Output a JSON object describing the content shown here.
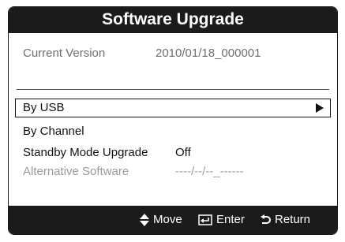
{
  "dialog": {
    "title": "Software Upgrade",
    "current_version_label": "Current Version",
    "current_version_value": "2010/01/18_000001"
  },
  "menu": {
    "items": [
      {
        "label": "By USB",
        "value": "",
        "selected": true,
        "disabled": false
      },
      {
        "label": "By Channel",
        "value": "",
        "selected": false,
        "disabled": false
      },
      {
        "label": "Standby Mode Upgrade",
        "value": "Off",
        "selected": false,
        "disabled": false
      },
      {
        "label": "Alternative Software",
        "value": "----/--/--_------",
        "selected": false,
        "disabled": true
      }
    ]
  },
  "footer": {
    "move_label": "Move",
    "enter_label": "Enter",
    "return_label": "Return"
  },
  "colors": {
    "bar": "#1b1b1b",
    "disabled_text": "#9a9a9a"
  }
}
